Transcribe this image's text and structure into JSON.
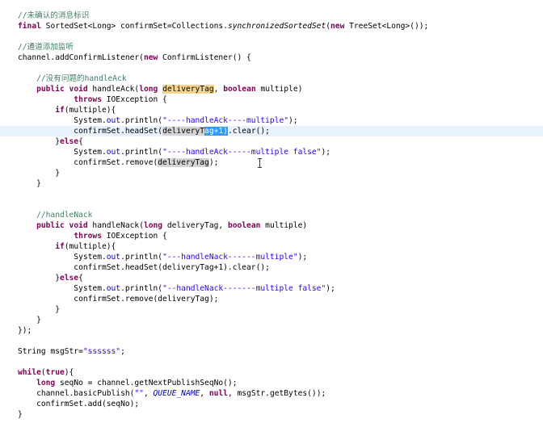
{
  "editor": {
    "language": "java",
    "colors": {
      "background": "#ffffff",
      "keyword": "#7f0055",
      "string": "#2a00ff",
      "comment": "#3f7f5f",
      "field": "#0000c0",
      "plain": "#000000",
      "current_line": "#e8f2fe",
      "highlight_declaration": "#f5d48b",
      "highlight_occurrence": "#d4d4d4",
      "selection": "#3399ff"
    },
    "cursor_icon": "i-beam-cursor-icon",
    "lines": [
      {
        "segments": [
          {
            "text": "//未确认的消息标识",
            "style": "cm"
          }
        ]
      },
      {
        "segments": [
          {
            "text": "final",
            "style": "kw"
          },
          {
            "text": " SortedSet<Long> confirmSet=Collections.",
            "style": ""
          },
          {
            "text": "synchronizedSortedSet",
            "style": "it"
          },
          {
            "text": "(",
            "style": ""
          },
          {
            "text": "new",
            "style": "kw"
          },
          {
            "text": " TreeSet<Long>());",
            "style": ""
          }
        ]
      },
      {
        "segments": []
      },
      {
        "segments": [
          {
            "text": "//通道添加监听",
            "style": "cm"
          }
        ]
      },
      {
        "segments": [
          {
            "text": "channel.addConfirmListener(",
            "style": ""
          },
          {
            "text": "new",
            "style": "kw"
          },
          {
            "text": " ConfirmListener() {",
            "style": ""
          }
        ]
      },
      {
        "segments": []
      },
      {
        "segments": [
          {
            "text": "    ",
            "style": ""
          },
          {
            "text": "//没有问题的handleAck",
            "style": "cm"
          }
        ]
      },
      {
        "segments": [
          {
            "text": "    ",
            "style": ""
          },
          {
            "text": "public",
            "style": "kw"
          },
          {
            "text": " ",
            "style": ""
          },
          {
            "text": "void",
            "style": "kw"
          },
          {
            "text": " handleAck(",
            "style": ""
          },
          {
            "text": "long",
            "style": "kw"
          },
          {
            "text": " ",
            "style": ""
          },
          {
            "text": "deliveryTag",
            "style": "hl-def"
          },
          {
            "text": ", ",
            "style": ""
          },
          {
            "text": "boolean",
            "style": "kw"
          },
          {
            "text": " multiple)",
            "style": ""
          }
        ]
      },
      {
        "segments": [
          {
            "text": "            ",
            "style": ""
          },
          {
            "text": "throws",
            "style": "kw"
          },
          {
            "text": " IOException {",
            "style": ""
          }
        ]
      },
      {
        "segments": [
          {
            "text": "        ",
            "style": ""
          },
          {
            "text": "if",
            "style": "kw"
          },
          {
            "text": "(multiple){",
            "style": ""
          }
        ]
      },
      {
        "segments": [
          {
            "text": "            System.",
            "style": ""
          },
          {
            "text": "out",
            "style": "fld"
          },
          {
            "text": ".println(",
            "style": ""
          },
          {
            "text": "\"----handleAck----multiple\"",
            "style": "str"
          },
          {
            "text": ");",
            "style": ""
          }
        ]
      },
      {
        "current": true,
        "segments": [
          {
            "text": "            confirmSet.headSet(",
            "style": ""
          },
          {
            "text": "deliveryT",
            "style": "hl-occ"
          },
          {
            "text": "ag+1)",
            "style": "sel"
          },
          {
            "text": ".clear();",
            "style": ""
          }
        ]
      },
      {
        "segments": [
          {
            "text": "        }",
            "style": ""
          },
          {
            "text": "else",
            "style": "kw"
          },
          {
            "text": "{",
            "style": ""
          }
        ]
      },
      {
        "segments": [
          {
            "text": "            System.",
            "style": ""
          },
          {
            "text": "out",
            "style": "fld"
          },
          {
            "text": ".println(",
            "style": ""
          },
          {
            "text": "\"----handleAck-----multiple false\"",
            "style": "str"
          },
          {
            "text": ");",
            "style": ""
          }
        ]
      },
      {
        "segments": [
          {
            "text": "            confirmSet.remove(",
            "style": ""
          },
          {
            "text": "deliveryTag",
            "style": "hl-occ"
          },
          {
            "text": ");",
            "style": ""
          }
        ]
      },
      {
        "segments": [
          {
            "text": "        }",
            "style": ""
          }
        ]
      },
      {
        "segments": [
          {
            "text": "    }",
            "style": ""
          }
        ]
      },
      {
        "segments": []
      },
      {
        "segments": []
      },
      {
        "segments": [
          {
            "text": "    ",
            "style": ""
          },
          {
            "text": "//handleNack",
            "style": "cm"
          }
        ]
      },
      {
        "segments": [
          {
            "text": "    ",
            "style": ""
          },
          {
            "text": "public",
            "style": "kw"
          },
          {
            "text": " ",
            "style": ""
          },
          {
            "text": "void",
            "style": "kw"
          },
          {
            "text": " handleNack(",
            "style": ""
          },
          {
            "text": "long",
            "style": "kw"
          },
          {
            "text": " deliveryTag, ",
            "style": ""
          },
          {
            "text": "boolean",
            "style": "kw"
          },
          {
            "text": " multiple)",
            "style": ""
          }
        ]
      },
      {
        "segments": [
          {
            "text": "            ",
            "style": ""
          },
          {
            "text": "throws",
            "style": "kw"
          },
          {
            "text": " IOException {",
            "style": ""
          }
        ]
      },
      {
        "segments": [
          {
            "text": "        ",
            "style": ""
          },
          {
            "text": "if",
            "style": "kw"
          },
          {
            "text": "(multiple){",
            "style": ""
          }
        ]
      },
      {
        "segments": [
          {
            "text": "            System.",
            "style": ""
          },
          {
            "text": "out",
            "style": "fld"
          },
          {
            "text": ".println(",
            "style": ""
          },
          {
            "text": "\"---handleNack------multiple\"",
            "style": "str"
          },
          {
            "text": ");",
            "style": ""
          }
        ]
      },
      {
        "segments": [
          {
            "text": "            confirmSet.headSet(deliveryTag+1).clear();",
            "style": ""
          }
        ]
      },
      {
        "segments": [
          {
            "text": "        }",
            "style": ""
          },
          {
            "text": "else",
            "style": "kw"
          },
          {
            "text": "{",
            "style": ""
          }
        ]
      },
      {
        "segments": [
          {
            "text": "            System.",
            "style": ""
          },
          {
            "text": "out",
            "style": "fld"
          },
          {
            "text": ".println(",
            "style": ""
          },
          {
            "text": "\"--handleNack-------multiple false\"",
            "style": "str"
          },
          {
            "text": ");",
            "style": ""
          }
        ]
      },
      {
        "segments": [
          {
            "text": "            confirmSet.remove(deliveryTag);",
            "style": ""
          }
        ]
      },
      {
        "segments": [
          {
            "text": "        }",
            "style": ""
          }
        ]
      },
      {
        "segments": [
          {
            "text": "    }",
            "style": ""
          }
        ]
      },
      {
        "segments": [
          {
            "text": "});",
            "style": ""
          }
        ]
      },
      {
        "segments": []
      },
      {
        "segments": [
          {
            "text": "String msgStr=",
            "style": ""
          },
          {
            "text": "\"ssssss\"",
            "style": "str"
          },
          {
            "text": ";",
            "style": ""
          }
        ]
      },
      {
        "segments": []
      },
      {
        "segments": [
          {
            "text": "while",
            "style": "kw"
          },
          {
            "text": "(",
            "style": ""
          },
          {
            "text": "true",
            "style": "kw"
          },
          {
            "text": "){",
            "style": ""
          }
        ]
      },
      {
        "segments": [
          {
            "text": "    ",
            "style": ""
          },
          {
            "text": "long",
            "style": "kw"
          },
          {
            "text": " seqNo = channel.getNextPublishSeqNo();",
            "style": ""
          }
        ]
      },
      {
        "segments": [
          {
            "text": "    channel.basicPublish(",
            "style": ""
          },
          {
            "text": "\"\"",
            "style": "str"
          },
          {
            "text": ", ",
            "style": ""
          },
          {
            "text": "QUEUE_NAME",
            "style": "fld it"
          },
          {
            "text": ", ",
            "style": ""
          },
          {
            "text": "null",
            "style": "kw"
          },
          {
            "text": ", msgStr.getBytes());",
            "style": ""
          }
        ]
      },
      {
        "segments": [
          {
            "text": "    confirmSet.add(seqNo);",
            "style": ""
          }
        ]
      },
      {
        "segments": [
          {
            "text": "}",
            "style": ""
          }
        ]
      }
    ]
  }
}
